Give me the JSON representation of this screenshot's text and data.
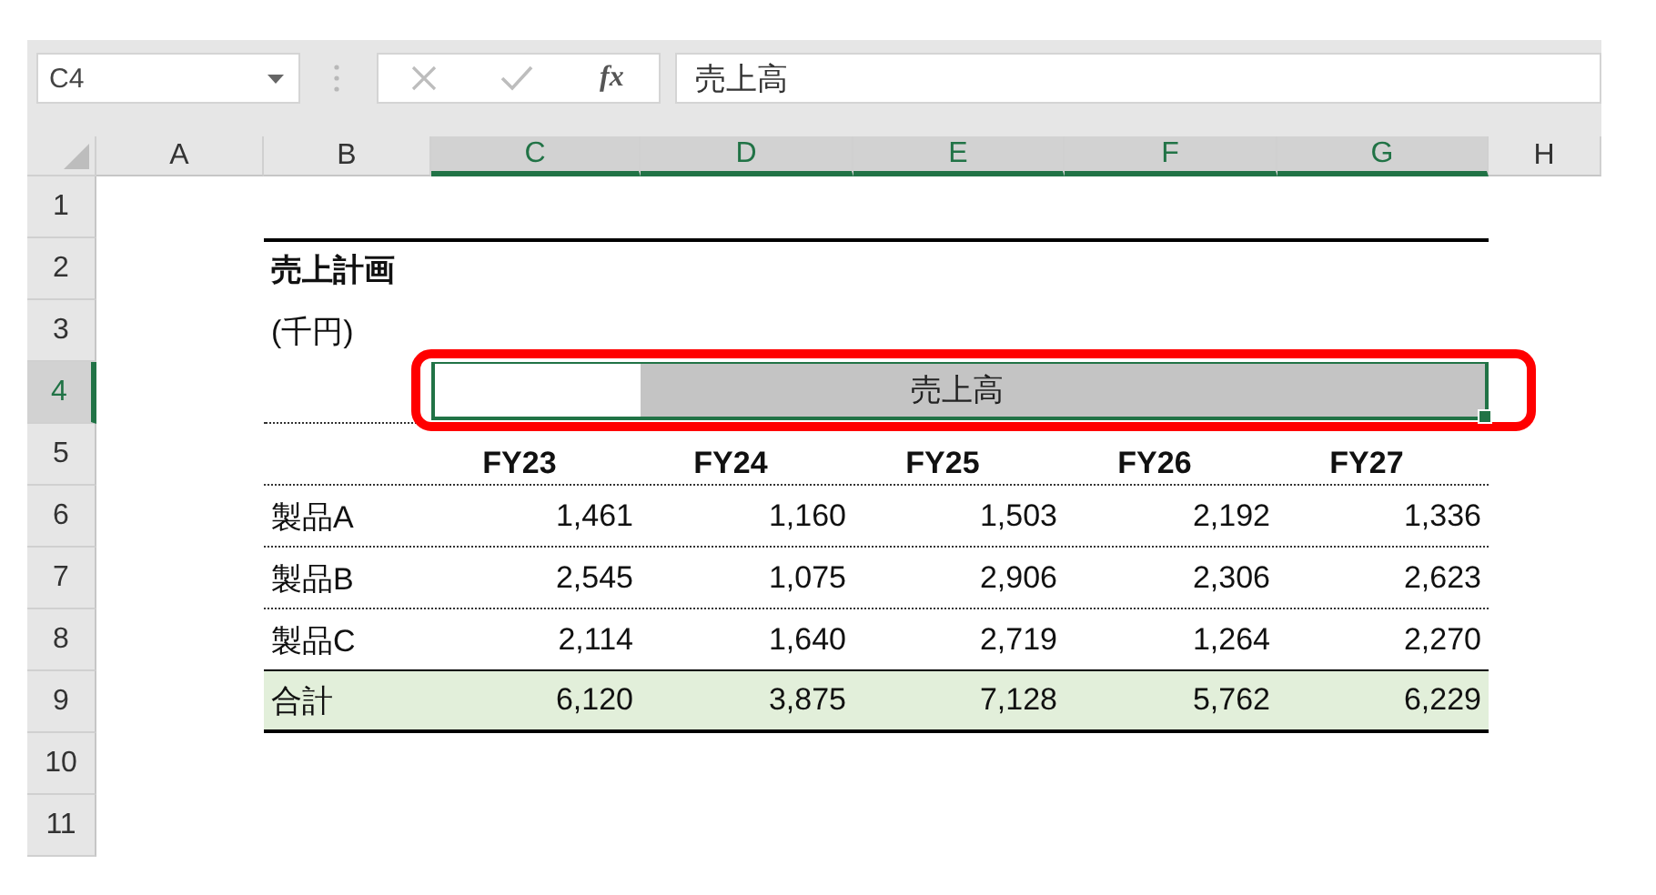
{
  "name_box": {
    "value": "C4"
  },
  "formula_bar": {
    "function_label": "fx",
    "value": "売上高"
  },
  "columns": [
    {
      "label": "A",
      "selected": false
    },
    {
      "label": "B",
      "selected": false
    },
    {
      "label": "C",
      "selected": true
    },
    {
      "label": "D",
      "selected": true
    },
    {
      "label": "E",
      "selected": true
    },
    {
      "label": "F",
      "selected": true
    },
    {
      "label": "G",
      "selected": true
    },
    {
      "label": "H",
      "selected": false
    }
  ],
  "rows": [
    {
      "label": "1",
      "selected": false
    },
    {
      "label": "2",
      "selected": false
    },
    {
      "label": "3",
      "selected": false
    },
    {
      "label": "4",
      "selected": true
    },
    {
      "label": "5",
      "selected": false
    },
    {
      "label": "6",
      "selected": false
    },
    {
      "label": "7",
      "selected": false
    },
    {
      "label": "8",
      "selected": false
    },
    {
      "label": "9",
      "selected": false
    },
    {
      "label": "10",
      "selected": false
    },
    {
      "label": "11",
      "selected": false
    }
  ],
  "sheet": {
    "title": "売上計画",
    "unit": "(千円)",
    "band_label": "売上高",
    "years": [
      "FY23",
      "FY24",
      "FY25",
      "FY26",
      "FY27"
    ],
    "products": [
      {
        "name": "製品A",
        "values": [
          "1,461",
          "1,160",
          "1,503",
          "2,192",
          "1,336"
        ]
      },
      {
        "name": "製品B",
        "values": [
          "2,545",
          "1,075",
          "2,906",
          "2,306",
          "2,623"
        ]
      },
      {
        "name": "製品C",
        "values": [
          "2,114",
          "1,640",
          "2,719",
          "1,264",
          "2,270"
        ]
      }
    ],
    "total": {
      "name": "合計",
      "values": [
        "6,120",
        "3,875",
        "7,128",
        "5,762",
        "6,229"
      ]
    }
  }
}
